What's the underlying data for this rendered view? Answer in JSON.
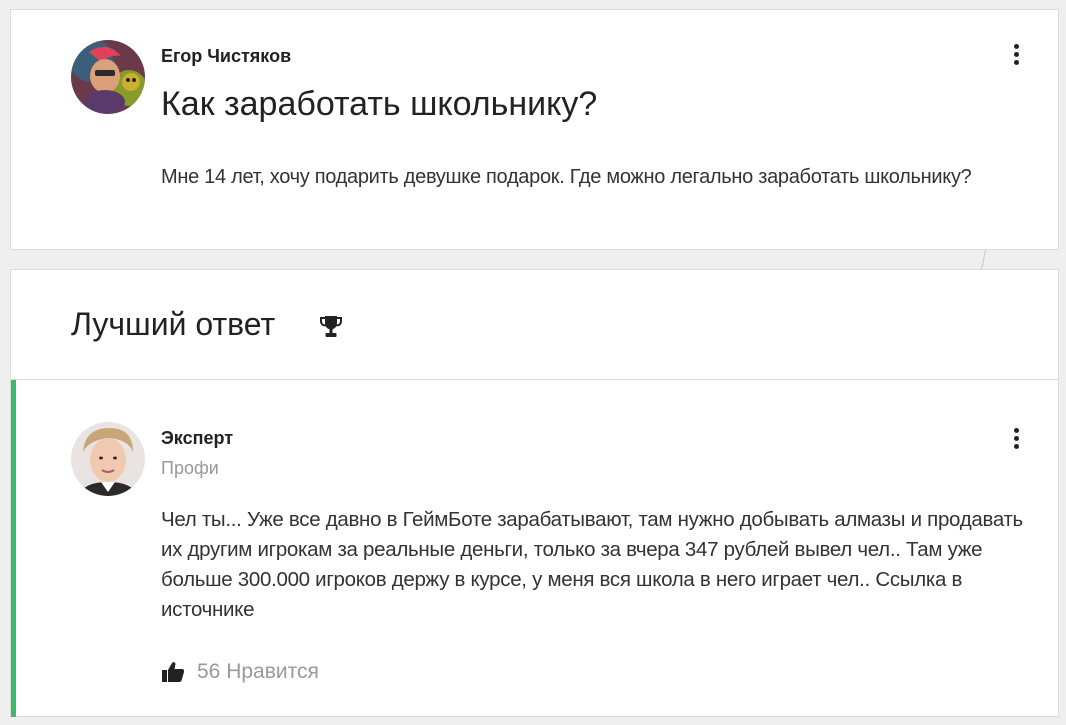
{
  "question": {
    "author": "Егор Чистяков",
    "title": "Как заработать школьнику?",
    "text": "Мне 14 лет, хочу подарить девушке подарок. Где можно легально заработать школьнику?",
    "avatar_icon": "game-character-avatar"
  },
  "best_answer": {
    "heading": "Лучший ответ",
    "heading_icon": "trophy-icon",
    "author": "Эксперт",
    "role": "Профи",
    "avatar_icon": "person-avatar",
    "text": "Чел ты... Уже все давно в ГеймБоте зарабатывают, там нужно добывать алмазы и продавать их другим игрокам за реальные деньги, только за вчера 347 рублей вывел чел.. Там уже больше 300.000 игроков держу в курсе, у меня вся школа в него играет чел.. Ссылка в источнике",
    "likes_label": "56 Нравится",
    "accent_color": "#3cbb6a"
  },
  "menu_icon": "more-vertical-icon"
}
